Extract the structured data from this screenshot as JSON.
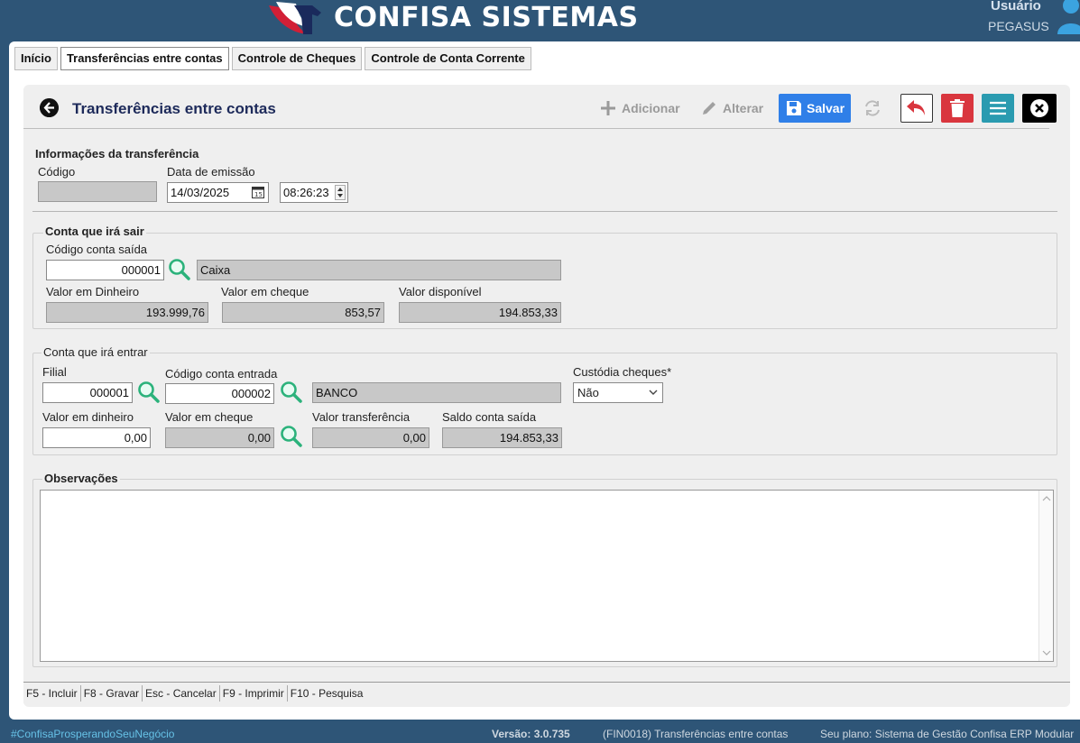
{
  "header": {
    "brand": "CONFISA SISTEMAS",
    "user_label": "Usuário",
    "user_name": "PEGASUS"
  },
  "tabs": [
    {
      "label": "Início"
    },
    {
      "label": "Transferências entre contas",
      "active": true
    },
    {
      "label": "Controle de Cheques"
    },
    {
      "label": "Controle de Conta Corrente"
    }
  ],
  "page": {
    "title": "Transferências entre contas"
  },
  "toolbar": {
    "add_label": "Adicionar",
    "edit_label": "Alterar",
    "save_label": "Salvar",
    "icons": [
      "plus-icon",
      "pencil-icon",
      "save-icon",
      "refresh-icon",
      "undo-icon",
      "trash-icon",
      "menu-icon",
      "close-icon"
    ],
    "colors": {
      "save": "#2f7fe8",
      "delete": "#d9363e",
      "menu": "#2a9bb0",
      "close": "#000000"
    }
  },
  "info": {
    "section_title": "Informações da transferência",
    "codigo_label": "Código",
    "codigo_value": "",
    "data_label": "Data de emissão",
    "data_value": "14/03/2025",
    "time_value": "08:26:23"
  },
  "saida": {
    "section_title": "Conta que irá sair",
    "codigo_label": "Código conta saída",
    "codigo_value": "000001",
    "conta_nome": "Caixa",
    "dinheiro_label": "Valor em Dinheiro",
    "dinheiro_value": "193.999,76",
    "cheque_label": "Valor em cheque",
    "cheque_value": "853,57",
    "disponivel_label": "Valor disponível",
    "disponivel_value": "194.853,33"
  },
  "entrada": {
    "section_title": "Conta que irá entrar",
    "filial_label": "Filial",
    "filial_value": "000001",
    "codigo_label": "Código conta entrada",
    "codigo_value": "000002",
    "conta_nome": "BANCO",
    "custodia_label": "Custódia cheques*",
    "custodia_value": "Não",
    "dinheiro_label": "Valor em dinheiro",
    "dinheiro_value": "0,00",
    "cheque_label": "Valor em cheque",
    "cheque_value": "0,00",
    "transferencia_label": "Valor transferência",
    "transferencia_value": "0,00",
    "saldo_label": "Saldo conta saída",
    "saldo_value": "194.853,33"
  },
  "observacoes": {
    "label": "Observações",
    "value": ""
  },
  "shortcuts": [
    "F5 - Incluir",
    "F8 - Gravar",
    "Esc - Cancelar",
    "F9 - Imprimir",
    "F10 - Pesquisa"
  ],
  "footer": {
    "hashtag": "#ConfisaProsperandoSeuNegócio",
    "version": "Versão: 3.0.735",
    "program": "(FIN0018) Transferências entre contas",
    "plan": "Seu plano: Sistema de Gestão Confisa ERP Modular"
  }
}
